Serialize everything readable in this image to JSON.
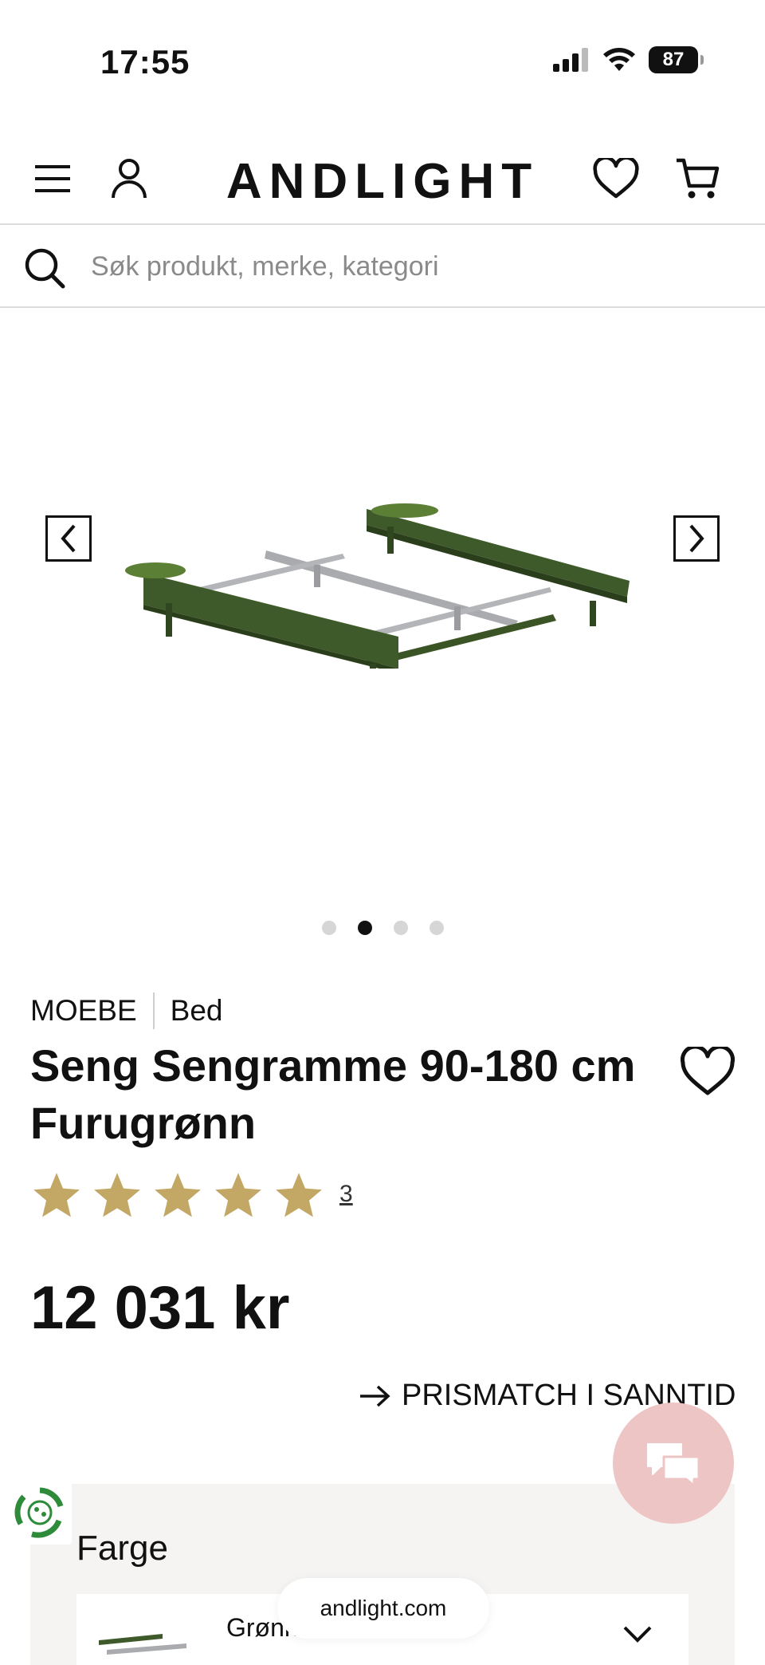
{
  "status_bar": {
    "time": "17:55",
    "battery": "87"
  },
  "header": {
    "logo": "ANDLIGHT"
  },
  "search": {
    "placeholder": "Søk produkt, merke, kategori"
  },
  "gallery": {
    "active_index": 1,
    "total_images": 4,
    "product_color": "#3f5a2a"
  },
  "product": {
    "brand": "MOEBE",
    "category": "Bed",
    "title": "Seng Sengramme 90-180 cm Furugrønn",
    "rating": 5,
    "review_count": "3",
    "price": "12 031 kr",
    "star_color": "#c2a765"
  },
  "prismatch": {
    "label": "PRISMATCH I SANNTID"
  },
  "color_selector": {
    "label": "Farge",
    "selected": "Grønn"
  },
  "browser": {
    "url": "andlight.com"
  }
}
